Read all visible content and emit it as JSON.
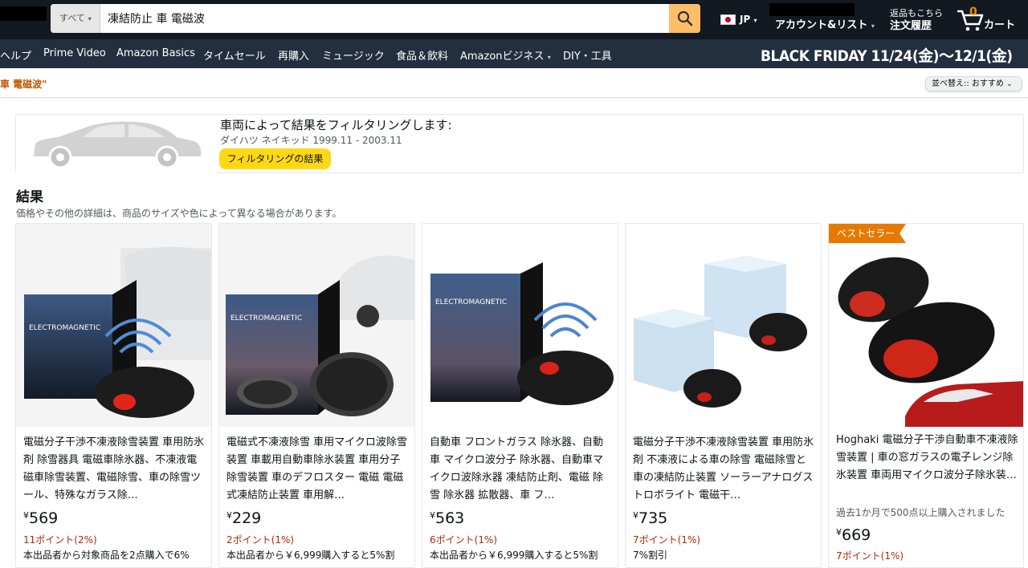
{
  "header": {
    "search_category": "すべて",
    "search_query": "凍結防止 車 電磁波",
    "lang": "JP",
    "account_label": "アカウント&リスト",
    "returns_line1": "返品もこちら",
    "returns_line2": "注文履歴",
    "cart_count": "0",
    "cart_label": "カート"
  },
  "subnav": {
    "items": [
      "ヘルプ",
      "Prime Video",
      "Amazon Basics",
      "タイムセール",
      "再購入",
      "ミュージック",
      "食品＆飲料",
      "Amazonビジネス",
      "DIY・工具"
    ],
    "promo": "BLACK FRIDAY  11/24(金)〜12/1(金)"
  },
  "results_bar": {
    "query_text": "車 電磁波\"",
    "sort_label": "並べ替え:: おすすめ"
  },
  "vehicle_filter": {
    "title": "車両によって結果をフィルタリングします:",
    "vehicle": "ダイハツ ネイキッド 1999.11 - 2003.11",
    "button": "フィルタリングの結果"
  },
  "results": {
    "title": "結果",
    "subtitle": "価格やその他の詳細は、商品のサイズや色によって異なる場合があります。"
  },
  "products": [
    {
      "title": "電磁分子干渉不凍液除雪装置 車用防氷剤 除雪器具 電磁車除氷器、不凍液電磁車除雪装置、電磁除雪、車の除雪ツール、特殊なガラス除…",
      "yen": "¥",
      "price": "569",
      "points": "11ポイント(2%)",
      "promo": "本出品者から対象商品を2点購入で6%",
      "badge": "",
      "bought": ""
    },
    {
      "title": "電磁式不凍液除雪 車用マイクロ波除雪装置 車載用自動車除氷装置 車用分子除雪装置 車のデフロスター 電磁 電磁式凍結防止装置 車用解…",
      "yen": "¥",
      "price": "229",
      "points": "2ポイント(1%)",
      "promo": "本出品者から￥6,999購入すると5%割",
      "badge": "",
      "bought": ""
    },
    {
      "title": "自動車 フロントガラス 除氷器、自動車 マイクロ波分子 除氷器、自動車マイクロ波除氷器 凍結防止剤、電磁 除雪 除氷器 拡散器、車 フ…",
      "yen": "¥",
      "price": "563",
      "points": "6ポイント(1%)",
      "promo": "本出品者から￥6,999購入すると5%割",
      "badge": "",
      "bought": ""
    },
    {
      "title": "電磁分子干渉不凍液除雪装置 車用防氷剤 不凍液による車の除雪 電磁除雪と車の凍結防止装置 ソーラーアナログストロボライト 電磁干…",
      "yen": "¥",
      "price": "735",
      "points": "7ポイント(1%)",
      "promo": "7%割引",
      "badge": "",
      "bought": ""
    },
    {
      "title": "Hoghaki 電磁分子干渉自動車不凍液除雪装置 | 車の窓ガラスの電子レンジ除氷装置 車両用マイクロ波分子除氷装置 車の雪氷除去用 - …",
      "yen": "¥",
      "price": "669",
      "points": "7ポイント(1%)",
      "promo": "",
      "badge": "ベストセラー",
      "bought": "過去1か月で500点以上購入されました"
    }
  ],
  "product_image_text": {
    "box_label": "ELECTROMAGNETIC"
  }
}
